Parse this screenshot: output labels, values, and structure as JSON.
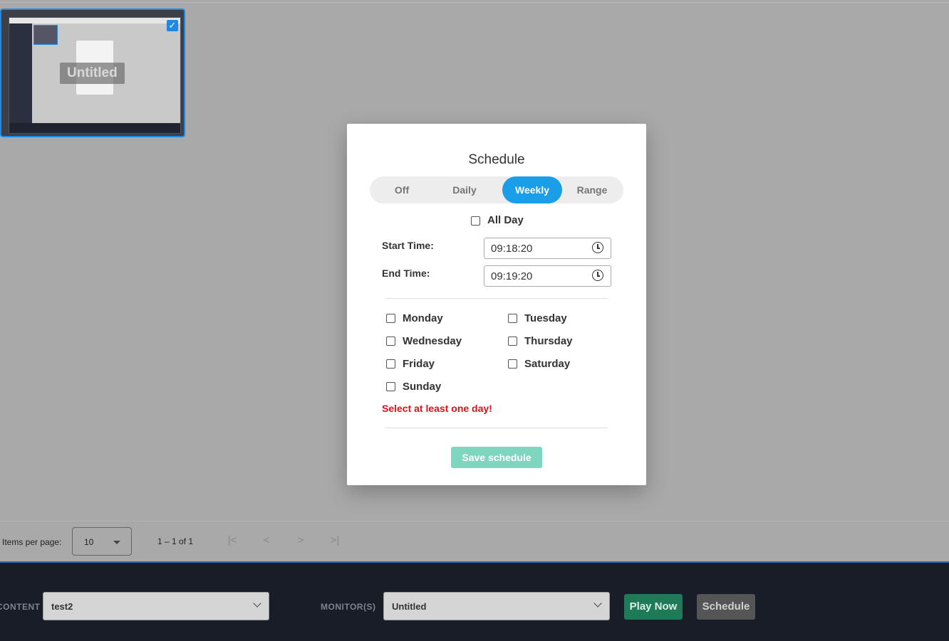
{
  "thumbnail": {
    "label": "Untitled",
    "checked": true
  },
  "paginator": {
    "items_per_page_label": "Items per page:",
    "items_per_page_value": "10",
    "range_label": "1 – 1 of 1"
  },
  "bottombar": {
    "content_label": "CONTENT",
    "content_value": "test2",
    "monitors_label": "MONITOR(S)",
    "monitors_value": "Untitled",
    "play_now": "Play Now",
    "schedule": "Schedule"
  },
  "dialog": {
    "title": "Schedule",
    "modes": [
      "Off",
      "Daily",
      "Weekly",
      "Range"
    ],
    "active_mode": "Weekly",
    "all_day_label": "All Day",
    "start_time_label": "Start Time:",
    "start_time_value": "09:18:20",
    "end_time_label": "End Time:",
    "end_time_value": "09:19:20",
    "days": [
      "Monday",
      "Tuesday",
      "Wednesday",
      "Thursday",
      "Friday",
      "Saturday",
      "Sunday"
    ],
    "error": "Select at least one day!",
    "save_label": "Save schedule"
  },
  "colors": {
    "accent": "#1a9ee8",
    "error": "#e0101a",
    "save_disabled": "#7fd6be",
    "play_now": "#1f7a58",
    "bottombar": "#181d27"
  }
}
